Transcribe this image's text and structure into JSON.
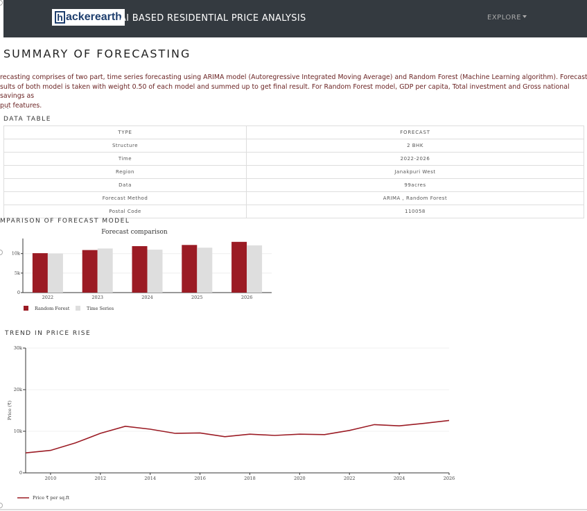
{
  "navbar": {
    "logo_h": "h",
    "logo_rest": "ackerearth",
    "title": "AI BASED RESIDENTIAL PRICE ANALYSIS",
    "explore": "EXPLORE"
  },
  "summary": {
    "title": "SUMMARY OF FORECASTING",
    "description": "recasting comprises of two part, time series forecasting using ARIMA model (Autoregressive Integrated Moving Average) and Random Forest (Machine Learning algorithm). Forecasted\nsults of both model is taken with weight 0.50 of each model and summed up to get final result. For Random Forest model, GDP per capita, Total investment and Gross national savings as\nput features.",
    "dots": ". ."
  },
  "data_table": {
    "label": "DATA TABLE",
    "headers": [
      "TYPE",
      "FORECAST"
    ],
    "rows": [
      [
        "Structure",
        "2 BHK"
      ],
      [
        "Time",
        "2022-2026"
      ],
      [
        "Region",
        "Janakpuri West"
      ],
      [
        "Data",
        "99acres"
      ],
      [
        "Forecast Method",
        "ARIMA , Random Forest"
      ],
      [
        "Postal Code",
        "110058"
      ]
    ]
  },
  "comparison": {
    "label": "MPARISON OF FORECAST MODEL"
  },
  "trend": {
    "label": "TREND IN PRICE RISE"
  },
  "chart_data": [
    {
      "type": "bar",
      "title": "Forecast comparison",
      "categories": [
        "2022",
        "2023",
        "2024",
        "2025",
        "2026"
      ],
      "series": [
        {
          "name": "Random Forest",
          "values": [
            10100,
            10900,
            11900,
            12200,
            13000
          ]
        },
        {
          "name": "Time Series",
          "values": [
            10000,
            11300,
            11000,
            11500,
            12100
          ]
        }
      ],
      "yticks": [
        0,
        5000,
        10000
      ],
      "ytick_labels": [
        "0",
        "5k",
        "10k"
      ],
      "ylim": [
        0,
        13500
      ],
      "colors": [
        "#9b1b24",
        "#dedede"
      ],
      "legend": "bottom-left",
      "grid": true
    },
    {
      "type": "line",
      "title": "",
      "ylabel": "Price (₹)",
      "x": [
        2009,
        2010,
        2011,
        2012,
        2013,
        2014,
        2015,
        2016,
        2017,
        2018,
        2019,
        2020,
        2021,
        2022,
        2023,
        2024,
        2025,
        2026
      ],
      "series": [
        {
          "name": "Price ₹ per sq.ft",
          "values": [
            4800,
            5400,
            7200,
            9500,
            11200,
            10500,
            9500,
            9600,
            8700,
            9300,
            9000,
            9300,
            9200,
            10200,
            11600,
            11300,
            11900,
            12600
          ]
        }
      ],
      "xticks": [
        "2010",
        "2012",
        "2014",
        "2016",
        "2018",
        "2020",
        "2022",
        "2024",
        "2026"
      ],
      "yticks": [
        0,
        10000,
        20000,
        30000
      ],
      "ytick_labels": [
        "0",
        "10k",
        "20k",
        "30k"
      ],
      "xlim": [
        2009,
        2026
      ],
      "ylim": [
        0,
        30000
      ],
      "color": "#9b1b24",
      "legend": "bottom-left",
      "grid": true
    }
  ]
}
